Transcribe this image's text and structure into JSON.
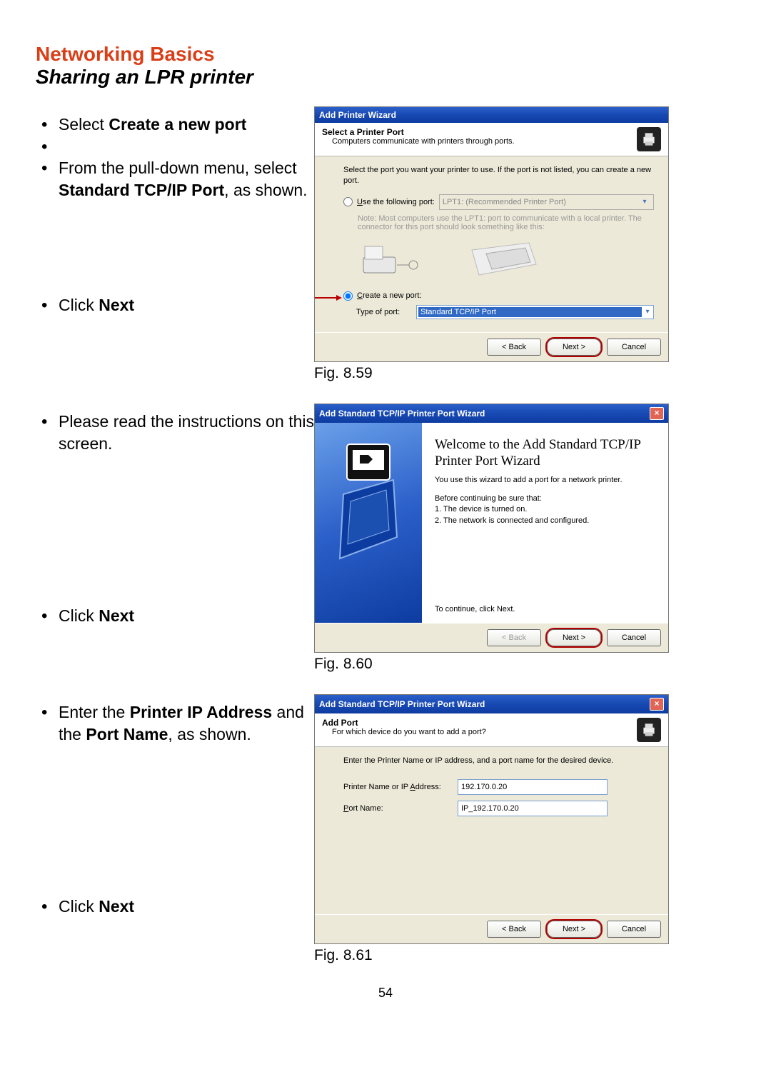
{
  "page_title": "Networking Basics",
  "page_subtitle": "Sharing an LPR printer",
  "page_number": "54",
  "figures": {
    "f59": "Fig. 8.59",
    "f60": "Fig. 8.60",
    "f61": "Fig. 8.61"
  },
  "instructions": {
    "i1a": "Select ",
    "i1b": "Create a new port",
    "i2a": "From the pull-down menu, select ",
    "i2b": "Standard TCP/IP Port",
    "i2c": ", as shown.",
    "i3a": "Click ",
    "i3b": "Next",
    "i4": "Please read the instructions on this screen.",
    "i5a": "Click ",
    "i5b": "Next",
    "i6a": "Enter the ",
    "i6b": "Printer IP Address",
    "i6c": " and the ",
    "i6d": "Port Name",
    "i6e": ", as shown.",
    "i7a": "Click ",
    "i7b": "Next"
  },
  "dlg59": {
    "title": "Add Printer Wizard",
    "header_title": "Select a Printer Port",
    "header_sub": "Computers communicate with printers through ports.",
    "intro": "Select the port you want your printer to use. If the port is not listed, you can create a new port.",
    "radio_use": "Use the following port:",
    "combo_use_val": "LPT1: (Recommended Printer Port)",
    "note": "Note: Most computers use the LPT1: port to communicate with a local printer. The connector for this port should look something like this:",
    "radio_create": "Create a new port:",
    "type_label": "Type of port:",
    "type_value": "Standard TCP/IP Port",
    "btn_back": "< Back",
    "btn_next": "Next >",
    "btn_cancel": "Cancel"
  },
  "dlg60": {
    "title": "Add Standard TCP/IP Printer Port Wizard",
    "welcome": "Welcome to the Add Standard TCP/IP Printer Port Wizard",
    "line1": "You use this wizard to add a port for a network printer.",
    "line2": "Before continuing be sure that:",
    "li1": "1.  The device is turned on.",
    "li2": "2.  The network is connected and configured.",
    "cont": "To continue, click Next.",
    "btn_back": "< Back",
    "btn_next": "Next >",
    "btn_cancel": "Cancel"
  },
  "dlg61": {
    "title": "Add Standard TCP/IP Printer Port Wizard",
    "header_title": "Add Port",
    "header_sub": "For which device do you want to add a port?",
    "intro": "Enter the Printer Name or IP address, and a port name for the desired device.",
    "field1_label": "Printer Name or IP Address:",
    "field1_value": "192.170.0.20",
    "field2_label": "Port Name:",
    "field2_value": "IP_192.170.0.20",
    "btn_back": "< Back",
    "btn_next": "Next >",
    "btn_cancel": "Cancel"
  }
}
